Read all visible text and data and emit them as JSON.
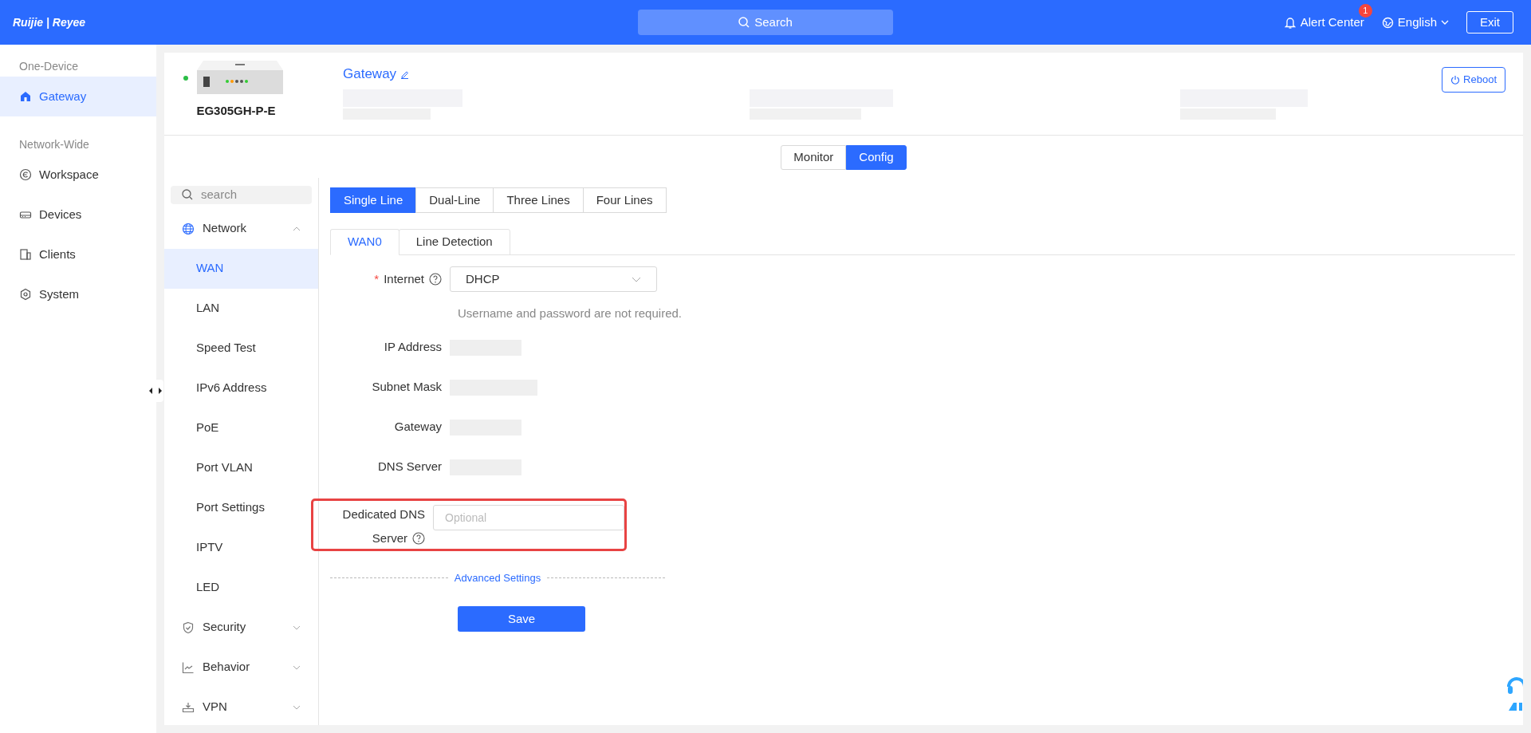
{
  "topbar": {
    "logo": "Ruijie | Reyee",
    "search": "Search",
    "alert": {
      "label": "Alert Center",
      "badge": "1"
    },
    "language": "English",
    "exit": "Exit"
  },
  "nav": {
    "sections": [
      {
        "title": "One-Device",
        "items": [
          {
            "label": "Gateway",
            "selected": true
          }
        ]
      },
      {
        "title": "Network-Wide",
        "items": [
          {
            "label": "Workspace",
            "selected": false
          },
          {
            "label": "Devices",
            "selected": false
          },
          {
            "label": "Clients",
            "selected": false
          },
          {
            "label": "System",
            "selected": false
          }
        ]
      }
    ]
  },
  "device": {
    "model": "EG305GH-P-E",
    "online": true,
    "name": "Gateway",
    "reboot": "Reboot"
  },
  "view_tabs": [
    {
      "label": "Monitor",
      "selected": false
    },
    {
      "label": "Config",
      "selected": true
    }
  ],
  "menu": {
    "search_placeholder": "search",
    "groups": [
      {
        "label": "Network",
        "expanded": true,
        "children": [
          {
            "label": "WAN",
            "selected": true
          },
          {
            "label": "LAN",
            "selected": false
          },
          {
            "label": "Speed Test",
            "selected": false
          },
          {
            "label": "IPv6 Address",
            "selected": false
          },
          {
            "label": "PoE",
            "selected": false
          },
          {
            "label": "Port VLAN",
            "selected": false
          },
          {
            "label": "Port Settings",
            "selected": false
          },
          {
            "label": "IPTV",
            "selected": false
          },
          {
            "label": "LED",
            "selected": false
          }
        ]
      },
      {
        "label": "Security",
        "expanded": false
      },
      {
        "label": "Behavior",
        "expanded": false
      },
      {
        "label": "VPN",
        "expanded": false
      }
    ]
  },
  "line_tabs": [
    {
      "label": "Single Line",
      "selected": true
    },
    {
      "label": "Dual-Line",
      "selected": false
    },
    {
      "label": "Three Lines",
      "selected": false
    },
    {
      "label": "Four Lines",
      "selected": false
    }
  ],
  "wan_tabs": [
    {
      "label": "WAN0",
      "selected": true
    },
    {
      "label": "Line Detection",
      "selected": false
    }
  ],
  "form": {
    "internet": {
      "label": "Internet",
      "required_mark": "*",
      "value": "DHCP",
      "hint": "Username and password are not required."
    },
    "readouts": [
      {
        "label": "IP Address"
      },
      {
        "label": "Subnet Mask"
      },
      {
        "label": "Gateway"
      },
      {
        "label": "DNS Server"
      }
    ],
    "dedicated_dns": {
      "label_lines": [
        "Dedicated DNS",
        "Server"
      ],
      "placeholder": "Optional",
      "highlighted": true
    },
    "advanced": "Advanced Settings",
    "save": "Save"
  }
}
